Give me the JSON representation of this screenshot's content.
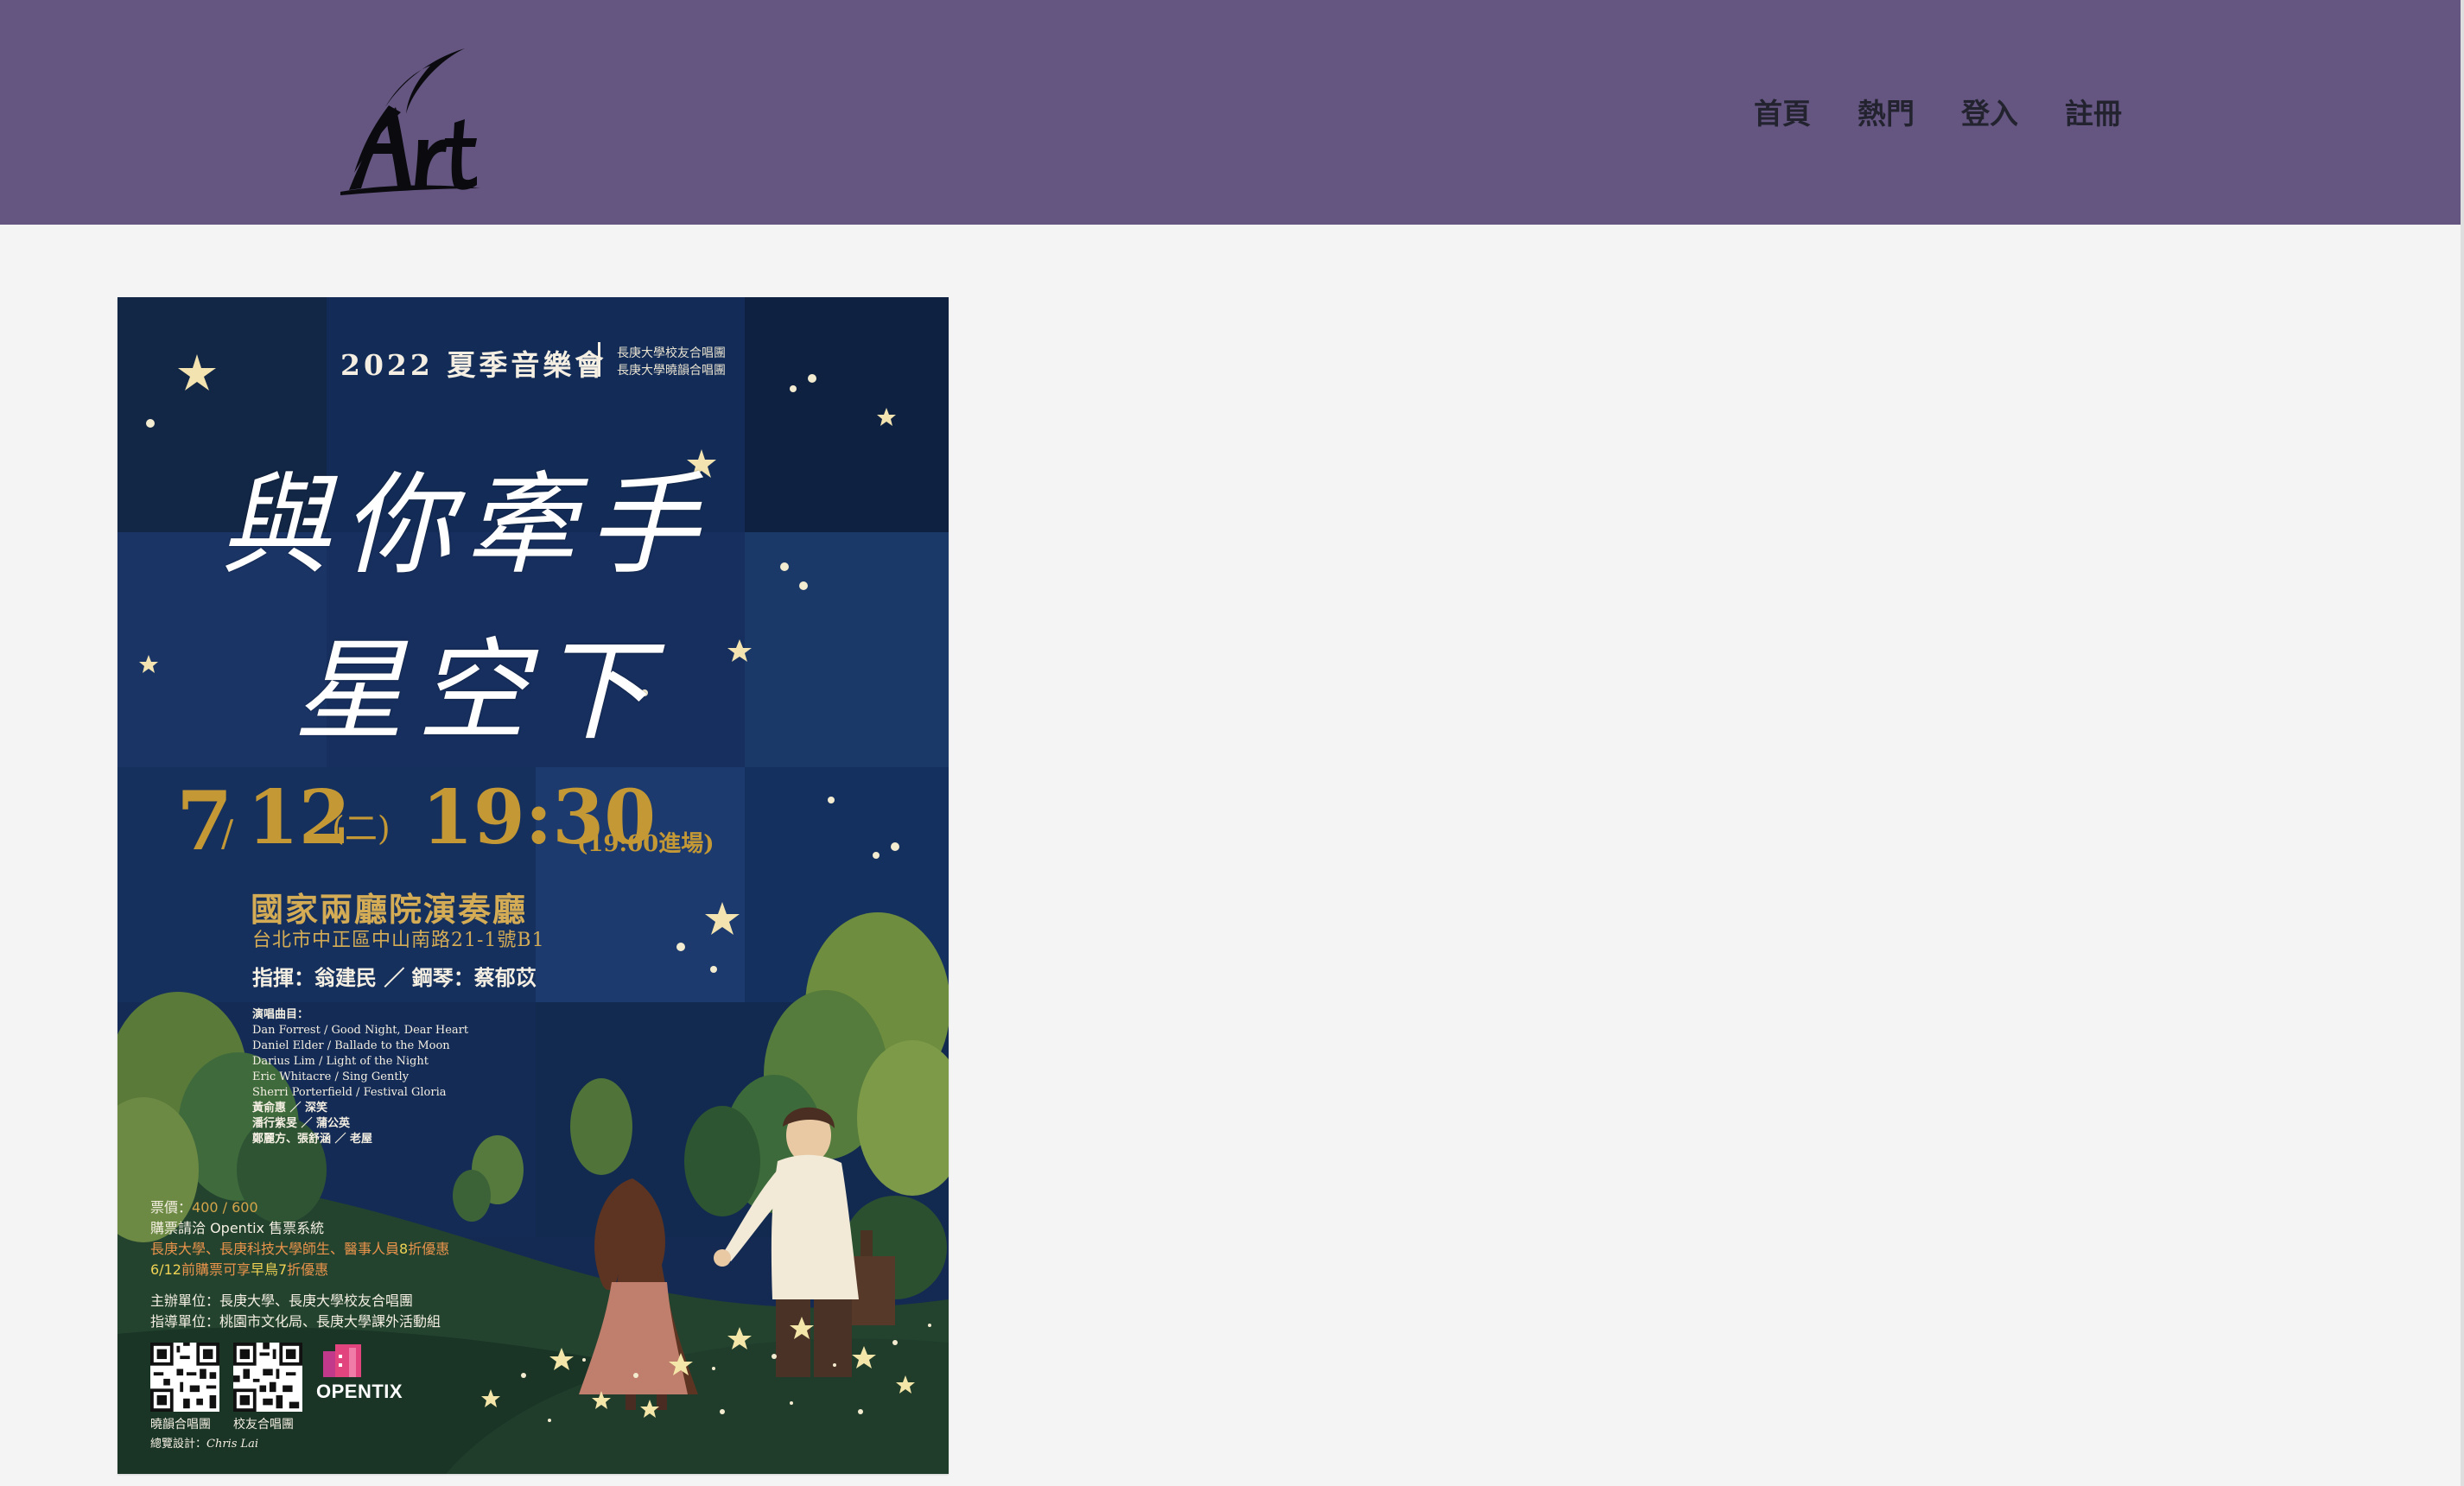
{
  "header": {
    "logo_text": "Art",
    "nav": [
      {
        "label": "首頁"
      },
      {
        "label": "熱門"
      },
      {
        "label": "登入"
      },
      {
        "label": "註冊"
      }
    ]
  },
  "colors": {
    "header_bg": "#655681",
    "page_bg": "#f4f4f4",
    "poster_sky": "#13264d",
    "poster_gold": "#c49935"
  },
  "poster": {
    "heading": "2022 夏季音樂會",
    "org_line1": "長庚大學校友合唱團",
    "org_line2": "長庚大學曉韻合唱團",
    "title_line1": "與你牽手",
    "title_line2": "星空下",
    "date_month": "7",
    "date_slash": "/",
    "date_day": "12",
    "date_weekday": "(二)",
    "time": "19:30",
    "entry_time": "(19:00進場)",
    "venue": "國家兩廳院演奏廳",
    "address": "台北市中正區中山南路21-1號B1",
    "credits": "指揮：翁建民 ／ 鋼琴：蔡郁苡",
    "program_header": "演唱曲目：",
    "program": [
      "Dan Forrest / Good Night, Dear Heart",
      "Daniel Elder / Ballade to the Moon",
      "Darius Lim / Light of the Night",
      "Eric Whitacre / Sing Gently",
      "Sherri Porterfield / Festival Gloria",
      "黃俞惠 ／ 深笑",
      "潘行紫旻 ／ 蒲公英",
      "鄭麗方、張舒涵 ／ 老屋"
    ],
    "price_label": "票價：",
    "price_value": "400 / 600",
    "ticketing": "購票請洽 Opentix 售票系統",
    "discount1_a": "長庚大學、長庚科技大學師生、醫事人員",
    "discount1_b": "8",
    "discount1_c": "折優惠",
    "discount2_a": "6/12",
    "discount2_b": "前購票可享",
    "discount2_c": "早鳥",
    "discount2_d": "7",
    "discount2_e": "折優惠",
    "organizer": "主辦單位：長庚大學、長庚大學校友合唱團",
    "supervisor": "指導單位：桃園市文化局、長庚大學課外活動組",
    "qr1_label": "曉韻合唱團",
    "qr2_label": "校友合唱團",
    "opentix": "OPENTIX",
    "designer_label": "總覽設計：",
    "designer_sig": "Chris Lai"
  }
}
